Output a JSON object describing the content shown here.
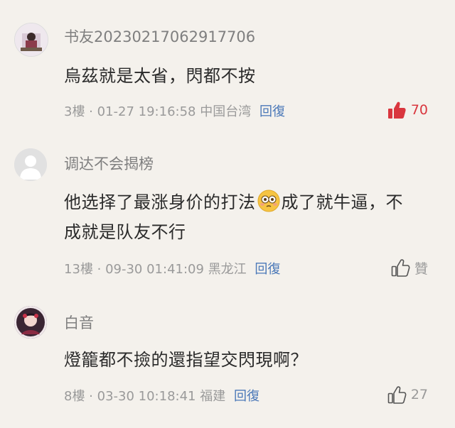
{
  "comments": [
    {
      "username": "书友20230217062917706",
      "content": "烏茲就是太省，閃都不按",
      "floor": "3樓",
      "datetime": "01-27 19:16:58",
      "location": "中国台湾",
      "reply_label": "回復",
      "likes": "70",
      "liked": true
    },
    {
      "username": "调达不会揭榜",
      "content_before_emoji": "他选择了最涨身价的打法",
      "emoji": "flushed-face-emoji",
      "content_after_emoji": "成了就牛逼，不成就是队友不行",
      "floor": "13樓",
      "datetime": "09-30 01:41:09",
      "location": "黑龙江",
      "reply_label": "回復",
      "like_label": "贊",
      "liked": false
    },
    {
      "username": "白音",
      "content": "燈籠都不撿的還指望交閃現啊？",
      "floor": "8樓",
      "datetime": "03-30 10:18:41",
      "location": "福建",
      "reply_label": "回復",
      "likes": "27",
      "liked": false
    }
  ],
  "colors": {
    "background": "#f4f1ec",
    "reply_link": "#4a78b8",
    "liked": "#d9363e",
    "muted": "#9a9a9a"
  }
}
